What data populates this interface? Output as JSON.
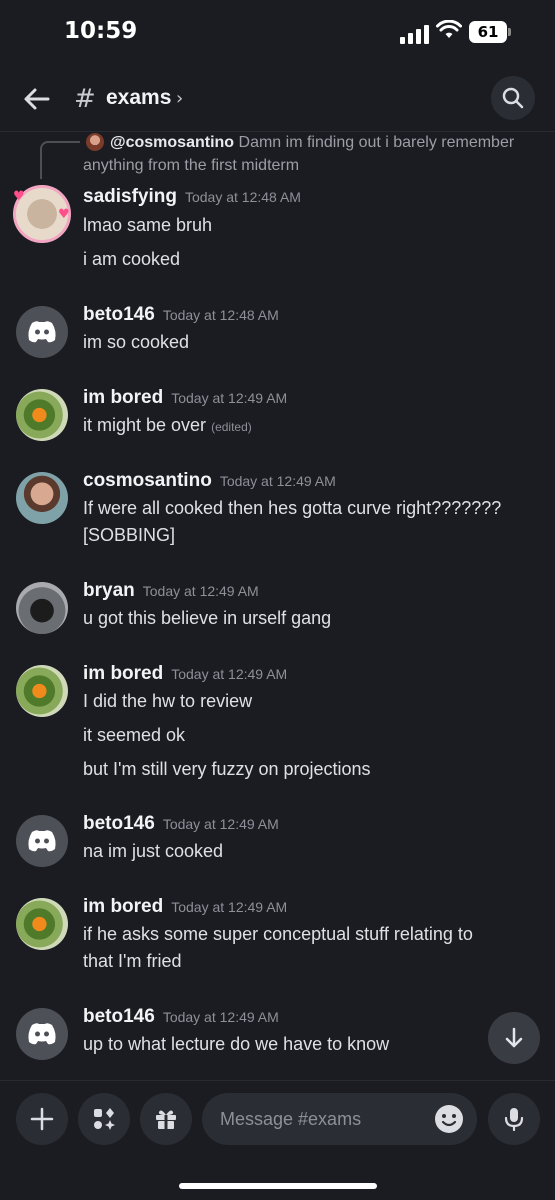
{
  "status_bar": {
    "time": "10:59",
    "battery": "61"
  },
  "header": {
    "hash": "#",
    "channel": "exams",
    "chevron": "›"
  },
  "reply": {
    "author": "@cosmosantino",
    "text": "Damn im finding out i barely remember anything from the first midterm"
  },
  "messages": [
    {
      "author": "sadisfying",
      "time": "Today at 12:48 AM",
      "avatar": "hamster-avatar",
      "lines": [
        "lmao same bruh",
        "i am cooked"
      ]
    },
    {
      "author": "beto146",
      "time": "Today at 12:48 AM",
      "avatar": "discord-default-avatar",
      "lines": [
        "im so cooked"
      ]
    },
    {
      "author": "im bored",
      "time": "Today at 12:49 AM",
      "avatar": "orange-tree-avatar",
      "lines": [
        "it might be over"
      ],
      "edited": "(edited)"
    },
    {
      "author": "cosmosantino",
      "time": "Today at 12:49 AM",
      "avatar": "person-avatar",
      "lines": [
        "If were all cooked then hes gotta curve right???????",
        "[SOBBING]"
      ]
    },
    {
      "author": "bryan",
      "time": "Today at 12:49 AM",
      "avatar": "cat-avatar",
      "lines": [
        "u got this believe in urself gang"
      ]
    },
    {
      "author": "im bored",
      "time": "Today at 12:49 AM",
      "avatar": "orange-tree-avatar",
      "lines": [
        "I did the hw to review",
        "it seemed ok",
        "but I'm still very fuzzy on projections"
      ]
    },
    {
      "author": "beto146",
      "time": "Today at 12:49 AM",
      "avatar": "discord-default-avatar",
      "lines": [
        "na im just cooked"
      ]
    },
    {
      "author": "im bored",
      "time": "Today at 12:49 AM",
      "avatar": "orange-tree-avatar",
      "lines": [
        "if he asks some super conceptual stuff relating to",
        "that I'm fried"
      ]
    },
    {
      "author": "beto146",
      "time": "Today at 12:49 AM",
      "avatar": "discord-default-avatar",
      "lines": [
        "up to what lecture do we have to know"
      ]
    }
  ],
  "composer": {
    "placeholder": "Message #exams"
  },
  "icons": [
    "back-arrow-icon",
    "search-icon",
    "plus-icon",
    "apps-icon",
    "gift-icon",
    "emoji-icon",
    "microphone-icon",
    "arrow-down-icon"
  ]
}
